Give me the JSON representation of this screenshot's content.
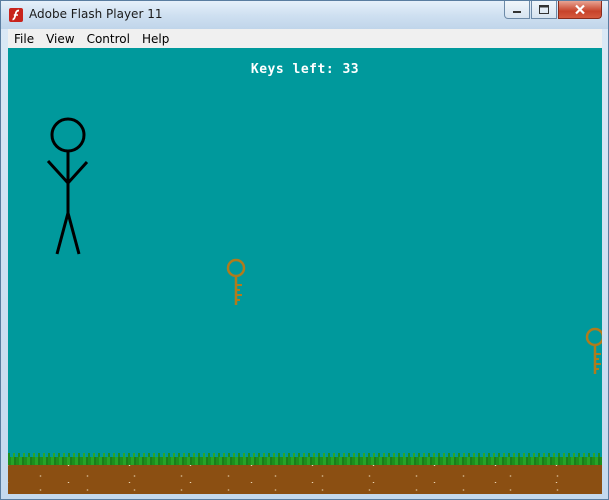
{
  "window": {
    "title": "Adobe Flash Player 11",
    "icon": "flash-player-icon"
  },
  "menubar": {
    "items": [
      "File",
      "View",
      "Control",
      "Help"
    ]
  },
  "game": {
    "hud_text": "Keys left: 33",
    "colors": {
      "background": "#00999c",
      "grass": "#1d8f1d",
      "dirt": "#8b4f12",
      "key": "#b07b1c",
      "stickman": "#000000",
      "hud_text": "#ffffff"
    },
    "sprites": [
      "stickman",
      "key",
      "key"
    ]
  }
}
